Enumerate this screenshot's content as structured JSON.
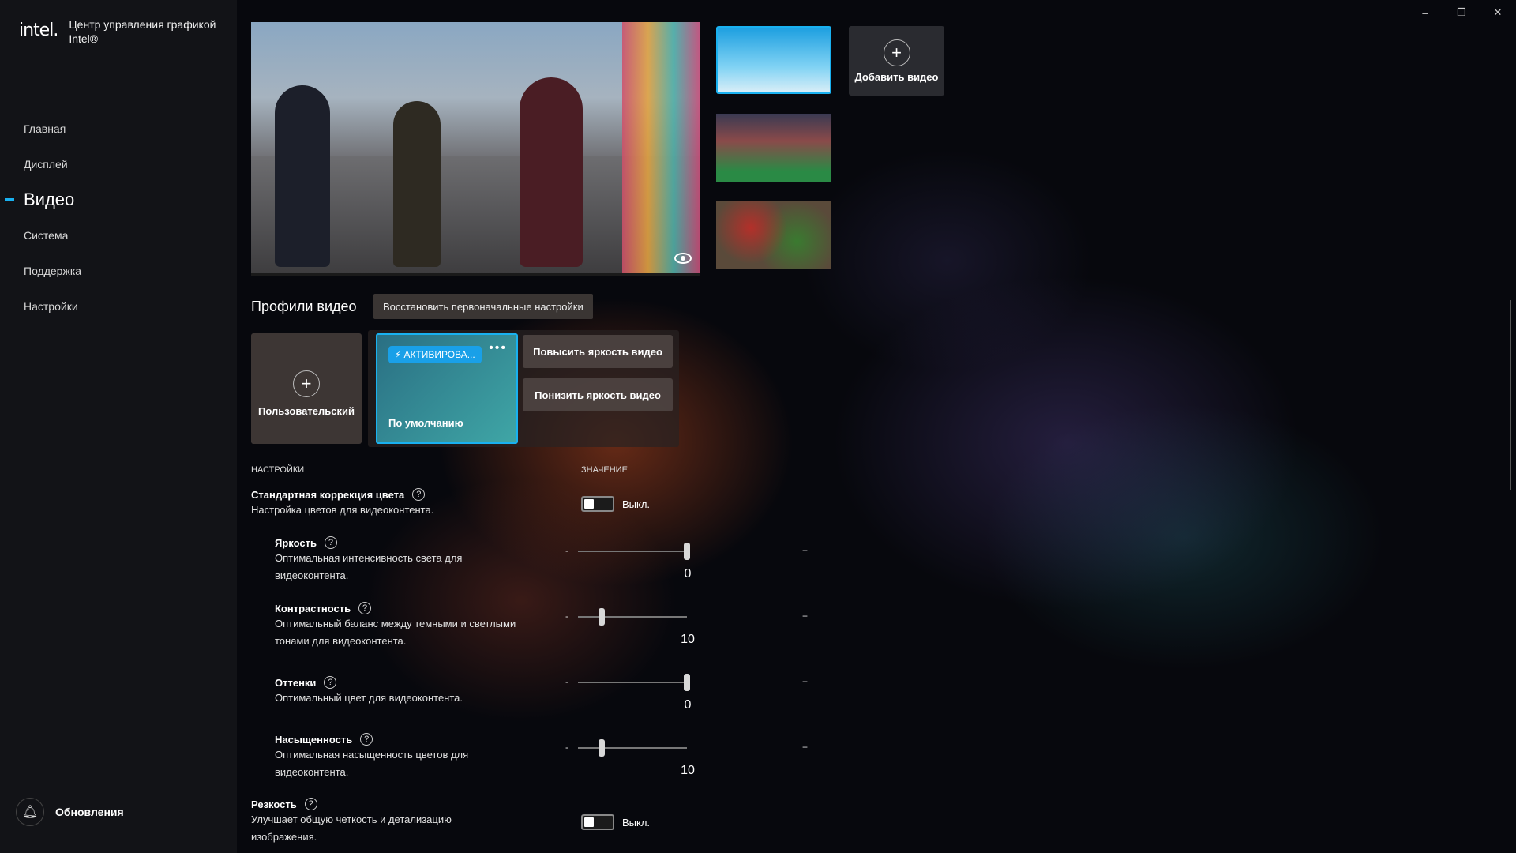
{
  "app": {
    "logo": "intel.",
    "title": "Центр управления графикой Intel®"
  },
  "nav": {
    "items": [
      {
        "label": "Главная"
      },
      {
        "label": "Дисплей"
      },
      {
        "label": "Видео",
        "active": true
      },
      {
        "label": "Система"
      },
      {
        "label": "Поддержка"
      },
      {
        "label": "Настройки"
      }
    ],
    "updates_label": "Обновления"
  },
  "window_controls": {
    "minimize": "–",
    "restore": "❐",
    "close": "✕"
  },
  "preview": {
    "thumbnails": [
      "snowboarder",
      "crowd-portrait",
      "market-stall"
    ],
    "selected_index": 0,
    "add_video_label": "Добавить видео"
  },
  "profiles": {
    "title": "Профили видео",
    "reset_label": "Восстановить первоначальные настройки",
    "custom_label": "Пользовательский",
    "default_badge": "АКТИВИРОВА...",
    "default_label": "По умолчанию",
    "more_label": "•••",
    "increase_label": "Повысить яркость видео",
    "decrease_label": "Понизить яркость видео"
  },
  "settings": {
    "col_settings": "НАСТРОЙКИ",
    "col_value": "ЗНАЧЕНИЕ",
    "color_correction": {
      "title": "Стандартная коррекция цвета",
      "desc": "Настройка цветов для видеоконтента.",
      "toggle_label": "Выкл.",
      "on": false
    },
    "brightness": {
      "title": "Яркость",
      "desc_1": "Оптимальная интенсивность света для",
      "desc_2": "видеоконтента.",
      "value": "0",
      "level": 1.0
    },
    "contrast": {
      "title": "Контрастность",
      "desc_1": "Оптимальный баланс между темными и светлыми",
      "desc_2": "тонами для видеоконтента.",
      "value": "10",
      "level": 0.22
    },
    "hue": {
      "title": "Оттенки",
      "desc_1": "Оптимальный цвет для видеоконтента.",
      "value": "0",
      "level": 1.0
    },
    "saturation": {
      "title": "Насыщенность",
      "desc_1": "Оптимальная насыщенность цветов для",
      "desc_2": "видеоконтента.",
      "value": "10",
      "level": 0.22
    },
    "sharpness": {
      "title": "Резкость",
      "desc_1": "Улучшает общую четкость и детализацию",
      "desc_2": "изображения.",
      "toggle_label": "Выкл.",
      "on": false
    },
    "minus": "-",
    "plus": "+",
    "help": "?"
  },
  "colors": {
    "accent": "#19b1f0",
    "sidebar_bg": "#121317",
    "badge_bg": "#19a0e8"
  }
}
